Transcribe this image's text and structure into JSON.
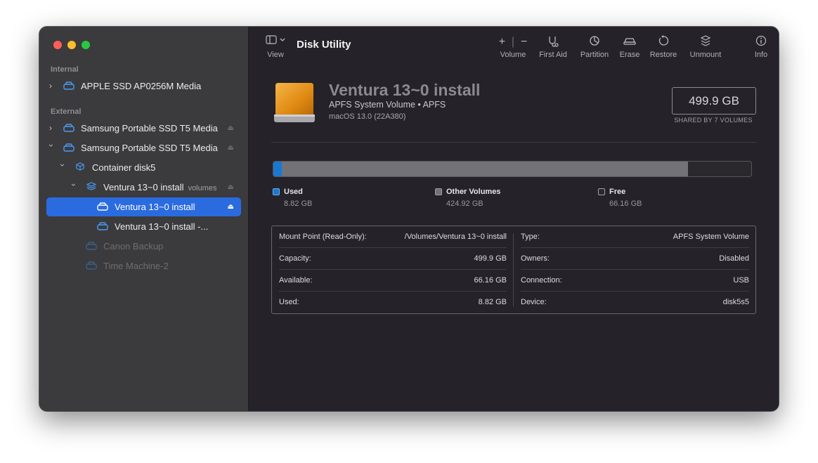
{
  "app": {
    "title": "Disk Utility"
  },
  "toolbar": {
    "view": {
      "icon": "sidebar-toggle-icon",
      "label": "View"
    },
    "volume": {
      "label": "Volume"
    },
    "first_aid": {
      "label": "First Aid"
    },
    "partition": {
      "label": "Partition"
    },
    "erase": {
      "label": "Erase"
    },
    "restore": {
      "label": "Restore"
    },
    "unmount": {
      "label": "Unmount"
    },
    "info": {
      "label": "Info"
    }
  },
  "sidebar": {
    "internal_label": "Internal",
    "external_label": "External",
    "items": [
      {
        "label": "APPLE SSD AP0256M Media",
        "sub": ""
      },
      {
        "label": "Samsung Portable SSD T5 Media",
        "sub": ""
      },
      {
        "label": "Samsung Portable SSD T5 Media",
        "sub": ""
      },
      {
        "label": "Container disk5",
        "sub": ""
      },
      {
        "label": "Ventura 13~0 install",
        "sub": "volumes"
      },
      {
        "label": "Ventura 13~0 install",
        "sub": ""
      },
      {
        "label": "Ventura 13~0 install -...",
        "sub": ""
      },
      {
        "label": "Canon Backup",
        "sub": ""
      },
      {
        "label": "Time Machine-2",
        "sub": ""
      }
    ]
  },
  "volume": {
    "name": "Ventura 13~0 install",
    "type_line": "APFS System Volume • APFS",
    "os_line": "macOS 13.0 (22A380)",
    "capacity": "499.9 GB",
    "shared": "SHARED BY 7 VOLUMES"
  },
  "usage": {
    "total_gb": 499.9,
    "used_gb": 8.82,
    "other_gb": 424.92,
    "free_gb": 66.16,
    "used_label": "Used",
    "used_value": "8.82 GB",
    "other_label": "Other Volumes",
    "other_value": "424.92 GB",
    "free_label": "Free",
    "free_value": "66.16 GB",
    "colors": {
      "used": "#1b78d0",
      "other": "#727277",
      "free": "#2a282d"
    }
  },
  "info": {
    "left": [
      {
        "key": "Mount Point (Read-Only):",
        "value": "/Volumes/Ventura 13~0 install"
      },
      {
        "key": "Capacity:",
        "value": "499.9 GB"
      },
      {
        "key": "Available:",
        "value": "66.16 GB"
      },
      {
        "key": "Used:",
        "value": "8.82 GB"
      }
    ],
    "right": [
      {
        "key": "Type:",
        "value": "APFS System Volume"
      },
      {
        "key": "Owners:",
        "value": "Disabled"
      },
      {
        "key": "Connection:",
        "value": "USB"
      },
      {
        "key": "Device:",
        "value": "disk5s5"
      }
    ]
  }
}
